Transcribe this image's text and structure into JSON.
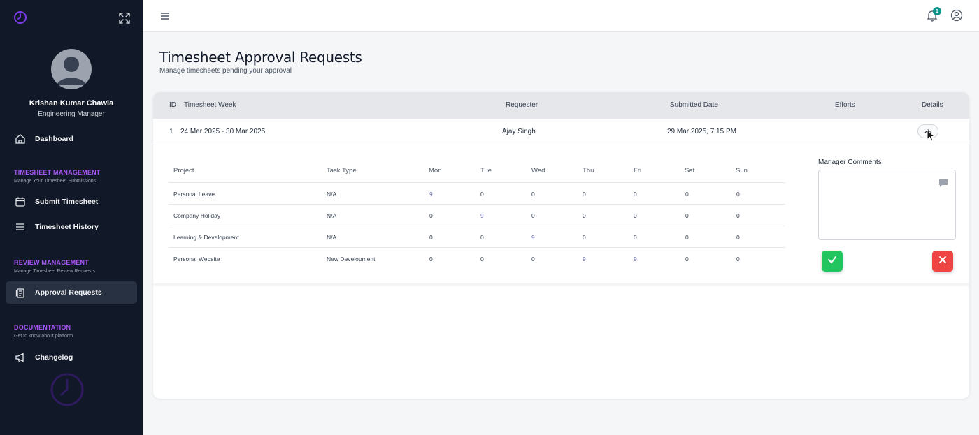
{
  "user": {
    "name": "Krishan Kumar Chawla",
    "role": "Engineering Manager"
  },
  "nav": {
    "dashboard": "Dashboard",
    "timesheet_section": {
      "title": "TIMESHEET MANAGEMENT",
      "subtitle": "Manage Your Timesheet Submissions"
    },
    "submit_timesheet": "Submit Timesheet",
    "timesheet_history": "Timesheet History",
    "review_section": {
      "title": "REVIEW MANAGEMENT",
      "subtitle": "Manage Timesheet Review Requests"
    },
    "approval_requests": "Approval Requests",
    "documentation_section": {
      "title": "DOCUMENTATION",
      "subtitle": "Get to know about platform"
    },
    "changelog": "Changelog"
  },
  "topbar": {
    "notification_count": "1"
  },
  "page": {
    "title": "Timesheet Approval Requests",
    "subtitle": "Manage timesheets pending your approval"
  },
  "table": {
    "headers": {
      "id": "ID",
      "week": "Timesheet Week",
      "requester": "Requester",
      "submitted": "Submitted Date",
      "efforts": "Efforts",
      "details": "Details"
    },
    "row": {
      "id": "1",
      "week": "24 Mar 2025 - 30 Mar 2025",
      "requester": "Ajay Singh",
      "submitted": "29 Mar 2025, 7:15 PM",
      "efforts": ""
    }
  },
  "details": {
    "headers": [
      "Project",
      "Task Type",
      "Mon",
      "Tue",
      "Wed",
      "Thu",
      "Fri",
      "Sat",
      "Sun"
    ],
    "rows": [
      [
        "Personal Leave",
        "N/A",
        "9",
        "0",
        "0",
        "0",
        "0",
        "0",
        "0"
      ],
      [
        "Company Holiday",
        "N/A",
        "0",
        "9",
        "0",
        "0",
        "0",
        "0",
        "0"
      ],
      [
        "Learning & Development",
        "N/A",
        "0",
        "0",
        "9",
        "0",
        "0",
        "0",
        "0"
      ],
      [
        "Personal Website",
        "New Development",
        "0",
        "0",
        "0",
        "9",
        "9",
        "0",
        "0"
      ]
    ],
    "manager_comments_label": "Manager Comments",
    "manager_comments_value": ""
  },
  "colors": {
    "sidebar_bg": "#111827",
    "accent": "#a855f7",
    "approve": "#22c55e",
    "reject": "#ef4444",
    "badge": "#0d9488"
  }
}
